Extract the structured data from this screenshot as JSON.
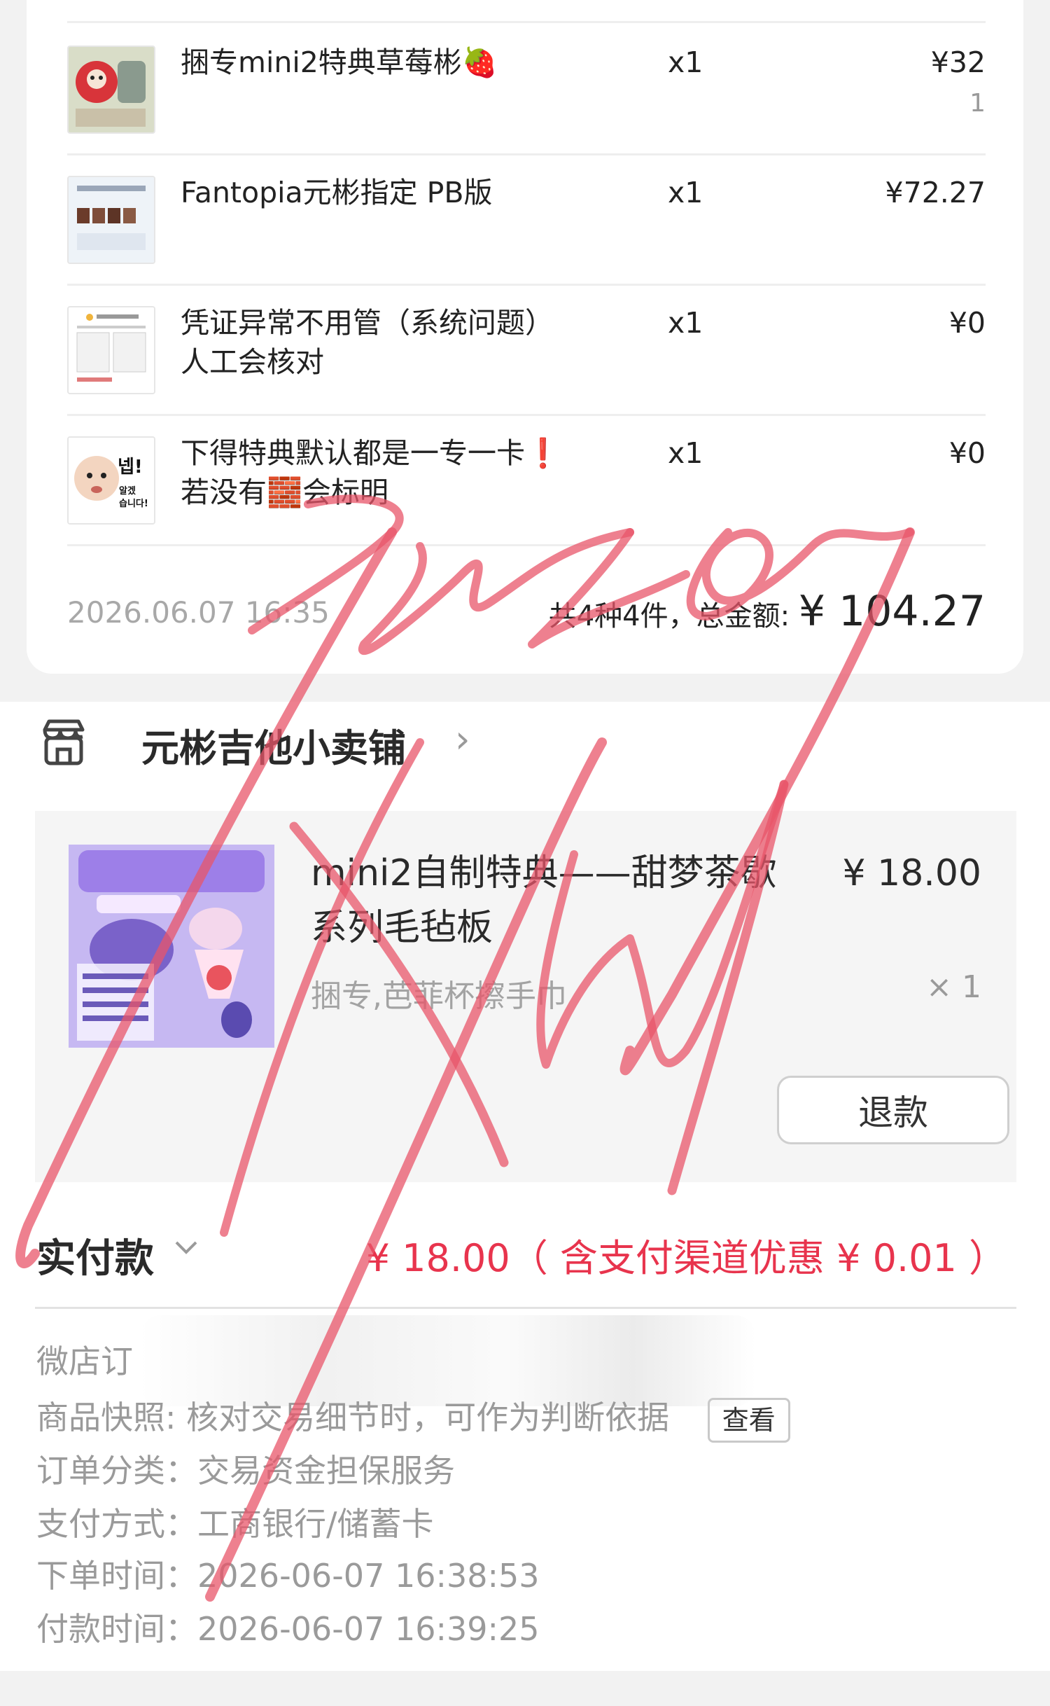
{
  "order_items": [
    {
      "name": "捆专mini2特典草莓彬🍓",
      "qty": "x1",
      "price": "¥32",
      "sub": "1"
    },
    {
      "name": "Fantopia元彬指定 PB版",
      "qty": "x1",
      "price": "¥72.27",
      "sub": ""
    },
    {
      "name": "凭证异常不用管（系统问题）人工会核对",
      "qty": "x1",
      "price": "¥0",
      "sub": ""
    },
    {
      "name": "下得特典默认都是一专一卡❗若没有🧱会标明",
      "qty": "x1",
      "price": "¥0",
      "sub": ""
    }
  ],
  "order_summary": {
    "time": "2026.06.07 16:35",
    "total_prefix": "共4种4件，总金额: ",
    "total_amount": "¥ 104.27"
  },
  "shop": {
    "name": "元彬吉他小卖铺",
    "chevron": "›"
  },
  "product": {
    "title": "mini2自制特典——甜梦茶歇系列毛毡板",
    "price": "¥ 18.00",
    "spec": "捆专,芭菲杯擦手巾",
    "qty": "× 1",
    "refund_label": "退款"
  },
  "payment": {
    "label": "实付款",
    "amount": "¥ 18.00（ 含支付渠道优惠 ¥ 0.01 ）"
  },
  "info": {
    "order_no_label": "微店订",
    "snapshot_label": "商品快照:",
    "snapshot_value": "核对交易细节时，可作为判断依据",
    "snapshot_button": "查看",
    "category_label": "订单分类：",
    "category_value": "交易资金担保服务",
    "pay_method_label": "支付方式：",
    "pay_method_value": "工商银行/储蓄卡",
    "order_time_label": "下单时间：",
    "order_time_value": "2026-06-07 16:38:53",
    "pay_time_label": "付款时间：",
    "pay_time_value": "2026-06-07 16:39:25"
  },
  "colors": {
    "accent_red": "#e8344d",
    "scribble": "#e8566a"
  },
  "icons": {
    "shop": "shop-icon",
    "chevron": "chevron-right-icon"
  }
}
